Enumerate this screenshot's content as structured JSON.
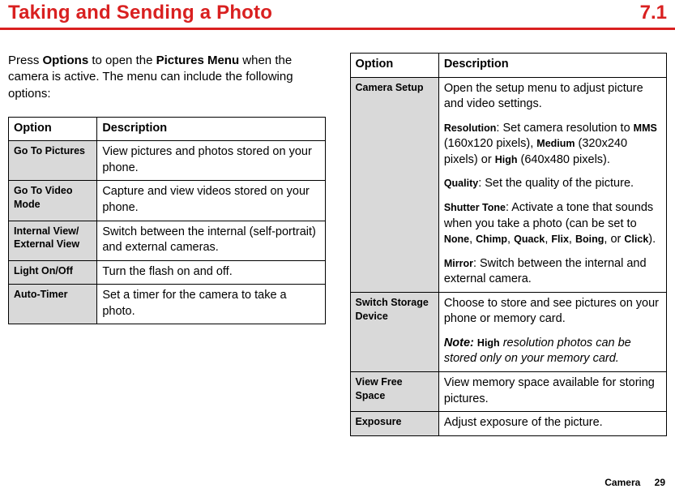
{
  "header": {
    "title": "Taking and Sending a Photo",
    "section_number": "7.1"
  },
  "intro": {
    "pre": "Press ",
    "options_word": "Options",
    "mid": " to open the ",
    "menu_word": "Pictures Menu",
    "post": " when the camera is active. The menu can include the following options:"
  },
  "left_table": {
    "headers": {
      "option": "Option",
      "description": "Description"
    },
    "rows": [
      {
        "option": "Go To Pictures",
        "desc": "View pictures and photos stored on your phone."
      },
      {
        "option": "Go To Video Mode",
        "desc": "Capture and view videos stored on your phone."
      },
      {
        "option": "Internal View/ External View",
        "desc": "Switch between the internal (self-portrait) and external cameras."
      },
      {
        "option": "Light On/Off",
        "desc": "Turn the flash on and off."
      },
      {
        "option": "Auto-Timer",
        "desc": "Set a timer for the camera to take a photo."
      }
    ]
  },
  "right_table": {
    "headers": {
      "option": "Option",
      "description": "Description"
    },
    "camera_setup": {
      "option": "Camera Setup",
      "intro": "Open the setup menu to adjust picture and video settings.",
      "resolution": {
        "kw": "Resolution",
        "pre": ": Set camera resolution to ",
        "v1": "MMS",
        "v1d": " (160x120 pixels), ",
        "v2": "Medium",
        "v2d": " (320x240 pixels) or ",
        "v3": "High",
        "v3d": " (640x480 pixels)."
      },
      "quality": {
        "kw": "Quality",
        "txt": ": Set the quality of the picture."
      },
      "shutter": {
        "kw": "Shutter Tone",
        "pre": ": Activate a tone that sounds when you take a photo (can be set to ",
        "o1": "None",
        "o2": "Chimp",
        "o3": "Quack",
        "o4": "Flix",
        "o5": "Boing",
        "o6": "Click",
        "sep": ", ",
        "or": ", or ",
        "end": ")."
      },
      "mirror": {
        "kw": "Mirror",
        "txt": ": Switch between the internal and external camera."
      }
    },
    "switch_storage": {
      "option": "Switch Storage Device",
      "intro": "Choose to store and see pictures on your phone or memory card.",
      "note_label": "Note:",
      "note_kw": "High",
      "note_rest": " resolution photos can be stored only on your memory card."
    },
    "view_free": {
      "option": "View Free Space",
      "desc": "View memory space available for storing pictures."
    },
    "exposure": {
      "option": "Exposure",
      "desc": "Adjust exposure of the picture."
    }
  },
  "footer": {
    "section": "Camera",
    "page": "29"
  }
}
